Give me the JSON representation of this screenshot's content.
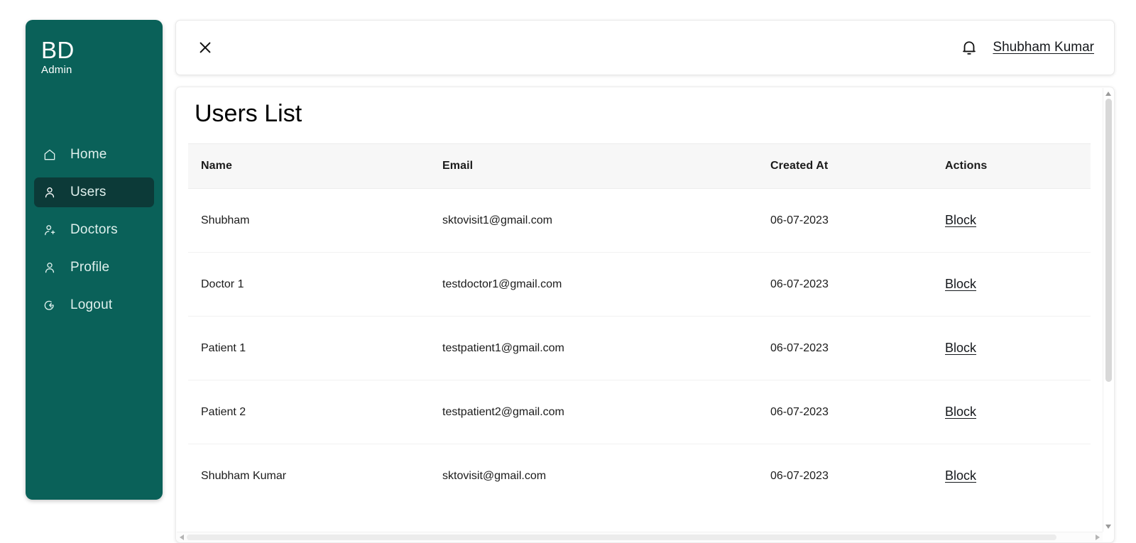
{
  "brand": {
    "title": "BD",
    "subtitle": "Admin"
  },
  "sidebar": {
    "items": [
      {
        "label": "Home",
        "icon": "home-icon",
        "active": false
      },
      {
        "label": "Users",
        "icon": "user-icon",
        "active": true
      },
      {
        "label": "Doctors",
        "icon": "doctor-icon",
        "active": false
      },
      {
        "label": "Profile",
        "icon": "profile-icon",
        "active": false
      },
      {
        "label": "Logout",
        "icon": "logout-icon",
        "active": false
      }
    ]
  },
  "topbar": {
    "close_icon": "close-icon",
    "bell_icon": "bell-icon",
    "user_name": "Shubham Kumar"
  },
  "main": {
    "page_title": "Users List",
    "table": {
      "columns": [
        "Name",
        "Email",
        "Created At",
        "Actions"
      ],
      "rows": [
        {
          "name": "Shubham",
          "email": "sktovisit1@gmail.com",
          "created_at": "06-07-2023",
          "action": "Block"
        },
        {
          "name": "Doctor 1",
          "email": "testdoctor1@gmail.com",
          "created_at": "06-07-2023",
          "action": "Block"
        },
        {
          "name": "Patient 1",
          "email": "testpatient1@gmail.com",
          "created_at": "06-07-2023",
          "action": "Block"
        },
        {
          "name": "Patient 2",
          "email": "testpatient2@gmail.com",
          "created_at": "06-07-2023",
          "action": "Block"
        },
        {
          "name": "Shubham Kumar",
          "email": "sktovisit@gmail.com",
          "created_at": "06-07-2023",
          "action": "Block"
        }
      ]
    }
  },
  "colors": {
    "sidebar_bg": "#0a6159",
    "sidebar_active_bg": "#0c3a38",
    "page_bg": "#ffffff",
    "table_header_bg": "#f7f7f7",
    "text": "#1b1b1b"
  }
}
